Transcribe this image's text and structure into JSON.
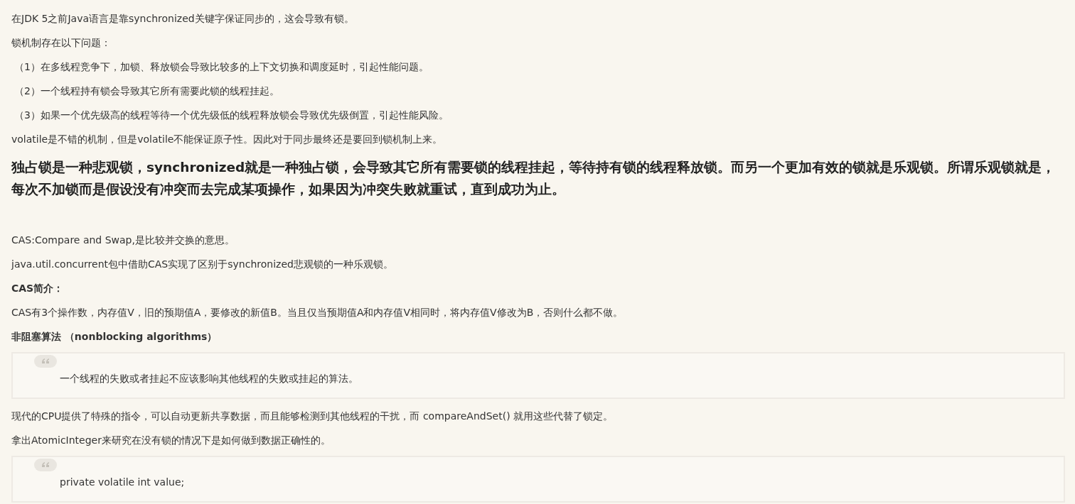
{
  "blocks": [
    {
      "kind": "para",
      "text": "在JDK 5之前Java语言是靠synchronized关键字保证同步的，这会导致有锁。"
    },
    {
      "kind": "para",
      "text": "锁机制存在以下问题："
    },
    {
      "kind": "item",
      "text": "（1）在多线程竞争下，加锁、释放锁会导致比较多的上下文切换和调度延时，引起性能问题。"
    },
    {
      "kind": "item",
      "text": "（2）一个线程持有锁会导致其它所有需要此锁的线程挂起。"
    },
    {
      "kind": "item",
      "text": "（3）如果一个优先级高的线程等待一个优先级低的线程释放锁会导致优先级倒置，引起性能风险。"
    },
    {
      "kind": "para",
      "text": "volatile是不错的机制，但是volatile不能保证原子性。因此对于同步最终还是要回到锁机制上来。"
    },
    {
      "kind": "heading",
      "text": "独占锁是一种悲观锁，synchronized就是一种独占锁，会导致其它所有需要锁的线程挂起，等待持有锁的线程释放锁。而另一个更加有效的锁就是乐观锁。所谓乐观锁就是，每次不加锁而是假设没有冲突而去完成某项操作，如果因为冲突失败就重试，直到成功为止。"
    },
    {
      "kind": "para",
      "text": "CAS:Compare and Swap,是比较并交换的意思。"
    },
    {
      "kind": "para",
      "text": "java.util.concurrent包中借助CAS实现了区别于synchronized悲观锁的一种乐观锁。"
    },
    {
      "kind": "bold",
      "text": "CAS简介："
    },
    {
      "kind": "para",
      "text": "CAS有3个操作数，内存值V，旧的预期值A，要修改的新值B。当且仅当预期值A和内存值V相同时，将内存值V修改为B，否则什么都不做。"
    },
    {
      "kind": "bold",
      "text": "非阻塞算法 （nonblocking algorithms）"
    },
    {
      "kind": "quote",
      "text": "一个线程的失败或者挂起不应该影响其他线程的失败或挂起的算法。"
    },
    {
      "kind": "para",
      "text": "现代的CPU提供了特殊的指令，可以自动更新共享数据，而且能够检测到其他线程的干扰，而 compareAndSet() 就用这些代替了锁定。"
    },
    {
      "kind": "para",
      "text": "拿出AtomicInteger来研究在没有锁的情况下是如何做到数据正确性的。"
    },
    {
      "kind": "quote",
      "text": "private volatile int value;"
    }
  ]
}
